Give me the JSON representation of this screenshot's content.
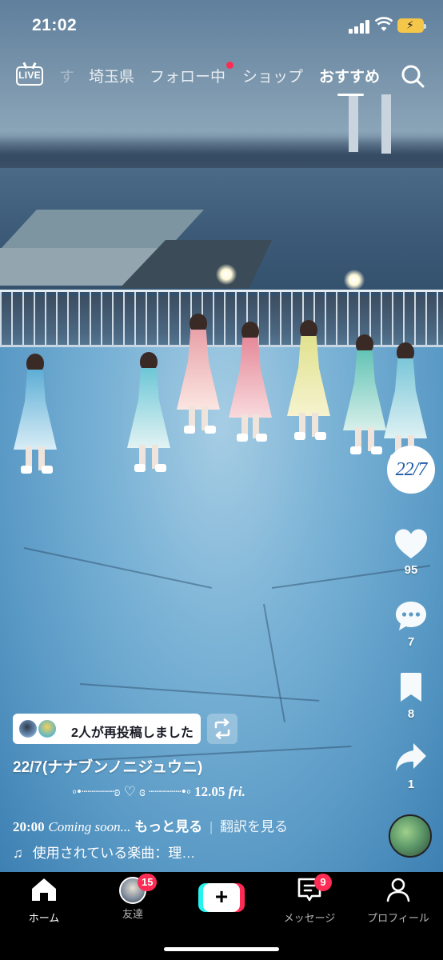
{
  "status_bar": {
    "time": "21:02"
  },
  "top_nav": {
    "live_label": "LIVE",
    "tabs": [
      {
        "label": "す"
      },
      {
        "label": "埼玉県"
      },
      {
        "label": "フォロー中"
      },
      {
        "label": "ショップ"
      },
      {
        "label": "おすすめ"
      }
    ],
    "active_tab": "おすすめ"
  },
  "actions": {
    "creator_avatar_text": "22/7",
    "likes": "95",
    "comments": "7",
    "saves": "8",
    "shares": "1"
  },
  "post": {
    "repost_text": "2人が再投稿しました",
    "author": "22/7(ナナブンノニジュウニ)",
    "deco_line": "◦•┈┈┈┈ʚ ♡ ɞ ┈┈┈┈•◦",
    "date": "12.05",
    "day": "fri.",
    "time": "20:00",
    "caption": "Coming soon...",
    "more": "もっと見る",
    "translate": "翻訳を見る",
    "music_label": "使用されている楽曲：理…"
  },
  "bottom_nav": {
    "home": "ホーム",
    "friends": "友達",
    "friends_badge": "15",
    "messages": "メッセージ",
    "messages_badge": "9",
    "profile": "プロフィール"
  },
  "colors": {
    "accent_red": "#fe2c55",
    "accent_cyan": "#25f4ee",
    "battery": "#f4c64a"
  }
}
